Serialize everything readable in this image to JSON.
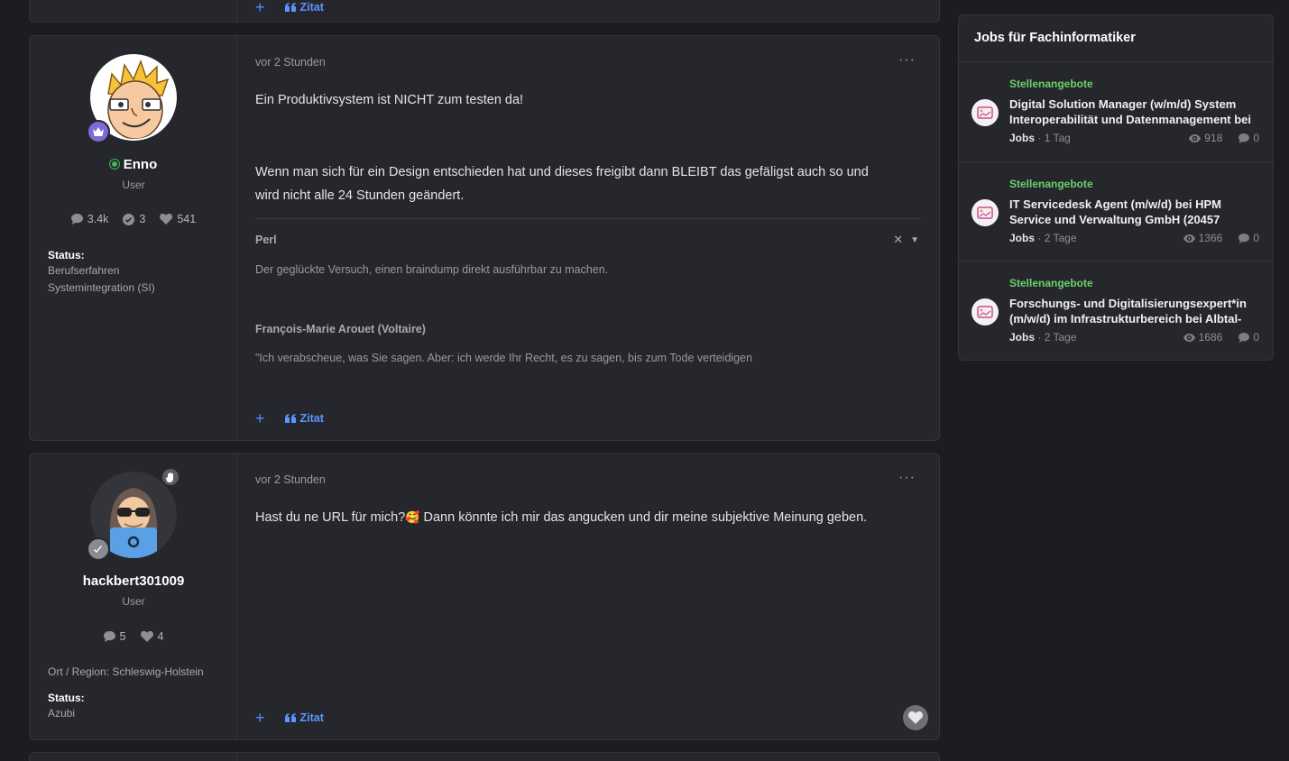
{
  "top_post_partial": {
    "quote_label": "Zitat"
  },
  "posts": [
    {
      "username": "Enno",
      "online": true,
      "role": "User",
      "stats": {
        "posts": "3.4k",
        "solutions": "3",
        "likes": "541"
      },
      "status_label": "Status:",
      "status_value_line1": "Berufserfahren",
      "status_value_line2": "Systemintegration (SI)",
      "time": "vor 2 Stunden",
      "body_line1": "Ein Produktivsystem ist NICHT zum testen da!",
      "body_line2": "Wenn man sich für ein Design entschieden hat und dieses freigibt dann BLEIBT das gefäligst auch so und",
      "body_line3": "wird nicht alle 24 Stunden geändert.",
      "sig_author": "Perl",
      "sig_quote": "Der geglückte Versuch, einen braindump direkt ausführbar zu machen.",
      "sig_author2": "François-Marie Arouet (Voltaire)",
      "sig_quote2": "\"Ich verabscheue, was Sie sagen. Aber: ich werde Ihr Recht, es zu sagen, bis zum Tode verteidigen",
      "quote_label": "Zitat"
    },
    {
      "username": "hackbert301009",
      "online": false,
      "role": "User",
      "stats": {
        "posts": "5",
        "likes": "4"
      },
      "region": "Ort / Region: Schleswig-Holstein",
      "status_label": "Status:",
      "status_value_line1": "Azubi",
      "time": "vor 2 Stunden",
      "body_before": "Hast du ne URL für mich?",
      "body_emoji": "🥰",
      "body_after": " Dann könnte ich mir das angucken und dir meine subjektive Meinung geben.",
      "quote_label": "Zitat"
    }
  ],
  "jobs_widget": {
    "title": "Jobs für Fachinformatiker",
    "items": [
      {
        "category": "Stellenangebote",
        "title": "Digital Solution Manager (w/m/d) System Interoperabilität und Datenmanagement bei",
        "forum": "Jobs",
        "age": "1 Tag",
        "views": "918",
        "replies": "0"
      },
      {
        "category": "Stellenangebote",
        "title": "IT Servicedesk Agent (m/w/d) bei HPM Service und Verwaltung GmbH (20457",
        "forum": "Jobs",
        "age": "2 Tage",
        "views": "1366",
        "replies": "0"
      },
      {
        "category": "Stellenangebote",
        "title": "Forschungs- und Digitalisierungsexpert*in (m/w/d) im Infrastrukturbereich bei Albtal-",
        "forum": "Jobs",
        "age": "2 Tage",
        "views": "1686",
        "replies": "0"
      }
    ],
    "separator": "·"
  },
  "colors": {
    "accent_blue": "#5b96ff",
    "category_green": "#6ad16a",
    "online_green": "#3fb950"
  }
}
